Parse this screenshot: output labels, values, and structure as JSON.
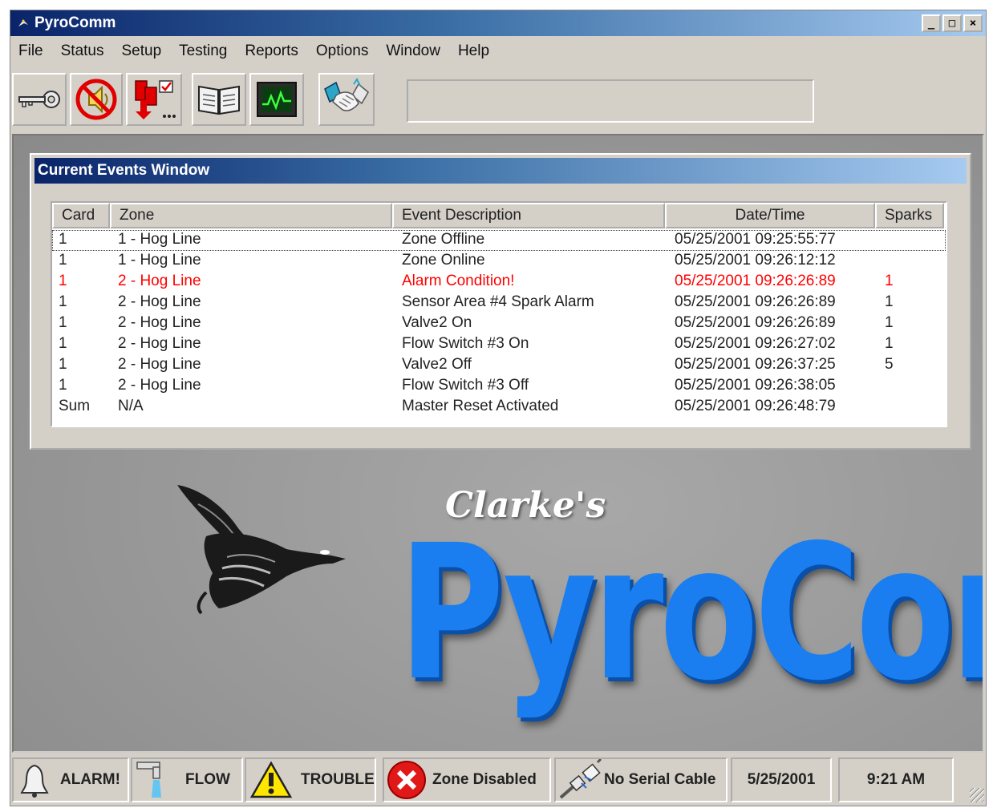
{
  "window": {
    "title": "PyroComm"
  },
  "menu": [
    "File",
    "Status",
    "Setup",
    "Testing",
    "Reports",
    "Options",
    "Window",
    "Help"
  ],
  "toolbar": {
    "buttons": [
      "key-icon",
      "silence-alarm-icon",
      "reset-icon",
      "manual-book-icon",
      "monitor-graph-icon",
      "handshake-icon"
    ],
    "message": ""
  },
  "events": {
    "title": "Current Events Window",
    "columns": [
      "Card",
      "Zone",
      "Event Description",
      "Date/Time",
      "Sparks"
    ],
    "rows": [
      {
        "card": "1",
        "zone": "1 - Hog Line",
        "description": "Zone Offline",
        "datetime": "05/25/2001 09:25:55:77",
        "sparks": "",
        "alarm": false
      },
      {
        "card": "1",
        "zone": "1 - Hog Line",
        "description": "Zone Online",
        "datetime": "05/25/2001 09:26:12:12",
        "sparks": "",
        "alarm": false
      },
      {
        "card": "1",
        "zone": "2 - Hog Line",
        "description": "Alarm Condition!",
        "datetime": "05/25/2001 09:26:26:89",
        "sparks": "1",
        "alarm": true
      },
      {
        "card": "1",
        "zone": "2 - Hog Line",
        "description": "Sensor Area #4 Spark Alarm",
        "datetime": "05/25/2001 09:26:26:89",
        "sparks": "1",
        "alarm": false
      },
      {
        "card": "1",
        "zone": "2 - Hog Line",
        "description": "Valve2 On",
        "datetime": "05/25/2001 09:26:26:89",
        "sparks": "1",
        "alarm": false
      },
      {
        "card": "1",
        "zone": "2 - Hog Line",
        "description": "Flow Switch #3 On",
        "datetime": "05/25/2001 09:26:27:02",
        "sparks": "1",
        "alarm": false
      },
      {
        "card": "1",
        "zone": "2 - Hog Line",
        "description": "Valve2 Off",
        "datetime": "05/25/2001 09:26:37:25",
        "sparks": "5",
        "alarm": false
      },
      {
        "card": "1",
        "zone": "2 - Hog Line",
        "description": "Flow Switch #3 Off",
        "datetime": "05/25/2001 09:26:38:05",
        "sparks": "",
        "alarm": false
      },
      {
        "card": "Sum",
        "zone": "N/A",
        "description": "Master Reset Activated",
        "datetime": "05/25/2001 09:26:48:79",
        "sparks": "",
        "alarm": false
      }
    ]
  },
  "logo": {
    "prefix": "Clarke's",
    "name": "PyroComm"
  },
  "status": {
    "alarm": "ALARM!",
    "flow": "FLOW",
    "trouble": "TROUBLE",
    "zone_disabled": "Zone Disabled",
    "serial": "No Serial Cable",
    "date": "5/25/2001",
    "time": "9:21 AM"
  },
  "colors": {
    "alarm_text": "#ff0000",
    "logo_blue": "#1a7ef0",
    "title_dark": "#0a246a"
  }
}
